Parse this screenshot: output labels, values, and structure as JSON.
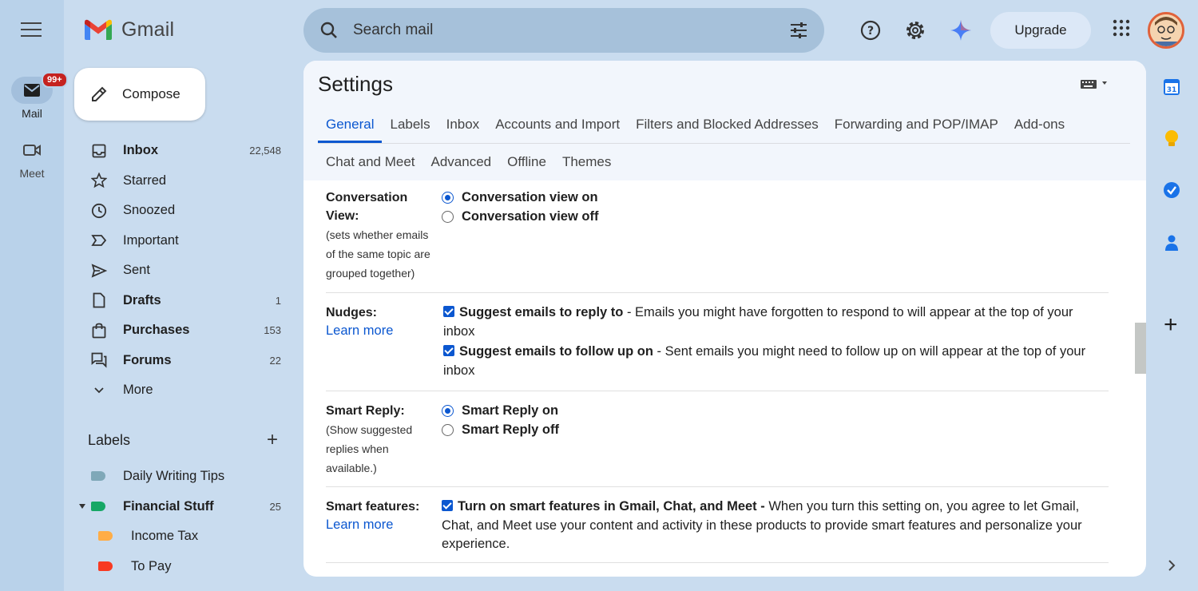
{
  "app": {
    "name": "Gmail"
  },
  "rail": {
    "mail_label": "Mail",
    "mail_badge": "99+",
    "meet_label": "Meet"
  },
  "search": {
    "placeholder": "Search mail"
  },
  "header": {
    "upgrade_label": "Upgrade"
  },
  "compose": {
    "label": "Compose"
  },
  "nav": {
    "items": [
      {
        "label": "Inbox",
        "count": "22,548",
        "bold": true,
        "icon": "inbox-icon"
      },
      {
        "label": "Starred",
        "count": "",
        "bold": false,
        "icon": "star-icon"
      },
      {
        "label": "Snoozed",
        "count": "",
        "bold": false,
        "icon": "clock-icon"
      },
      {
        "label": "Important",
        "count": "",
        "bold": false,
        "icon": "important-icon"
      },
      {
        "label": "Sent",
        "count": "",
        "bold": false,
        "icon": "send-icon"
      },
      {
        "label": "Drafts",
        "count": "1",
        "bold": true,
        "icon": "draft-icon"
      },
      {
        "label": "Purchases",
        "count": "153",
        "bold": true,
        "icon": "shopping-bag-icon"
      },
      {
        "label": "Forums",
        "count": "22",
        "bold": true,
        "icon": "forum-icon"
      },
      {
        "label": "More",
        "count": "",
        "bold": false,
        "icon": "chevron-down-icon"
      }
    ]
  },
  "labels": {
    "heading": "Labels",
    "items": [
      {
        "label": "Daily Writing Tips",
        "count": "",
        "color": "#7fa8b8"
      },
      {
        "label": "Financial Stuff",
        "count": "25",
        "color": "#16a765"
      },
      {
        "label": "Income Tax",
        "count": "",
        "color": "#ffad47"
      },
      {
        "label": "To Pay",
        "count": "",
        "color": "#f83a22"
      }
    ]
  },
  "settings": {
    "title": "Settings",
    "tabs_row1": [
      "General",
      "Labels",
      "Inbox",
      "Accounts and Import",
      "Filters and Blocked Addresses",
      "Forwarding and POP/IMAP",
      "Add-ons"
    ],
    "tabs_row2": [
      "Chat and Meet",
      "Advanced",
      "Offline",
      "Themes"
    ],
    "active_tab": "General",
    "conversation": {
      "label": "Conversation View:",
      "desc": "(sets whether emails of the same topic are grouped together)",
      "opt_on": "Conversation view on",
      "opt_off": "Conversation view off"
    },
    "nudges": {
      "label": "Nudges:",
      "learn_more": "Learn more",
      "reply_bold": "Suggest emails to reply to",
      "reply_text": " - Emails you might have forgotten to respond to will appear at the top of your inbox",
      "follow_bold": "Suggest emails to follow up on",
      "follow_text": " - Sent emails you might need to follow up on will appear at the top of your inbox"
    },
    "smart_reply": {
      "label": "Smart Reply:",
      "desc": "(Show suggested replies when available.)",
      "opt_on": "Smart Reply on",
      "opt_off": "Smart Reply off"
    },
    "smart_features": {
      "label": "Smart features:",
      "learn_more": "Learn more",
      "bold": "Turn on smart features in Gmail, Chat, and Meet -",
      "text": " When you turn this setting on, you agree to let Gmail, Chat, and Meet use your content and activity in these products to provide smart features and personalize your experience."
    }
  },
  "colors": {
    "accent": "#0b57d0",
    "background": "#c9dcef",
    "badge": "#c5221f"
  }
}
